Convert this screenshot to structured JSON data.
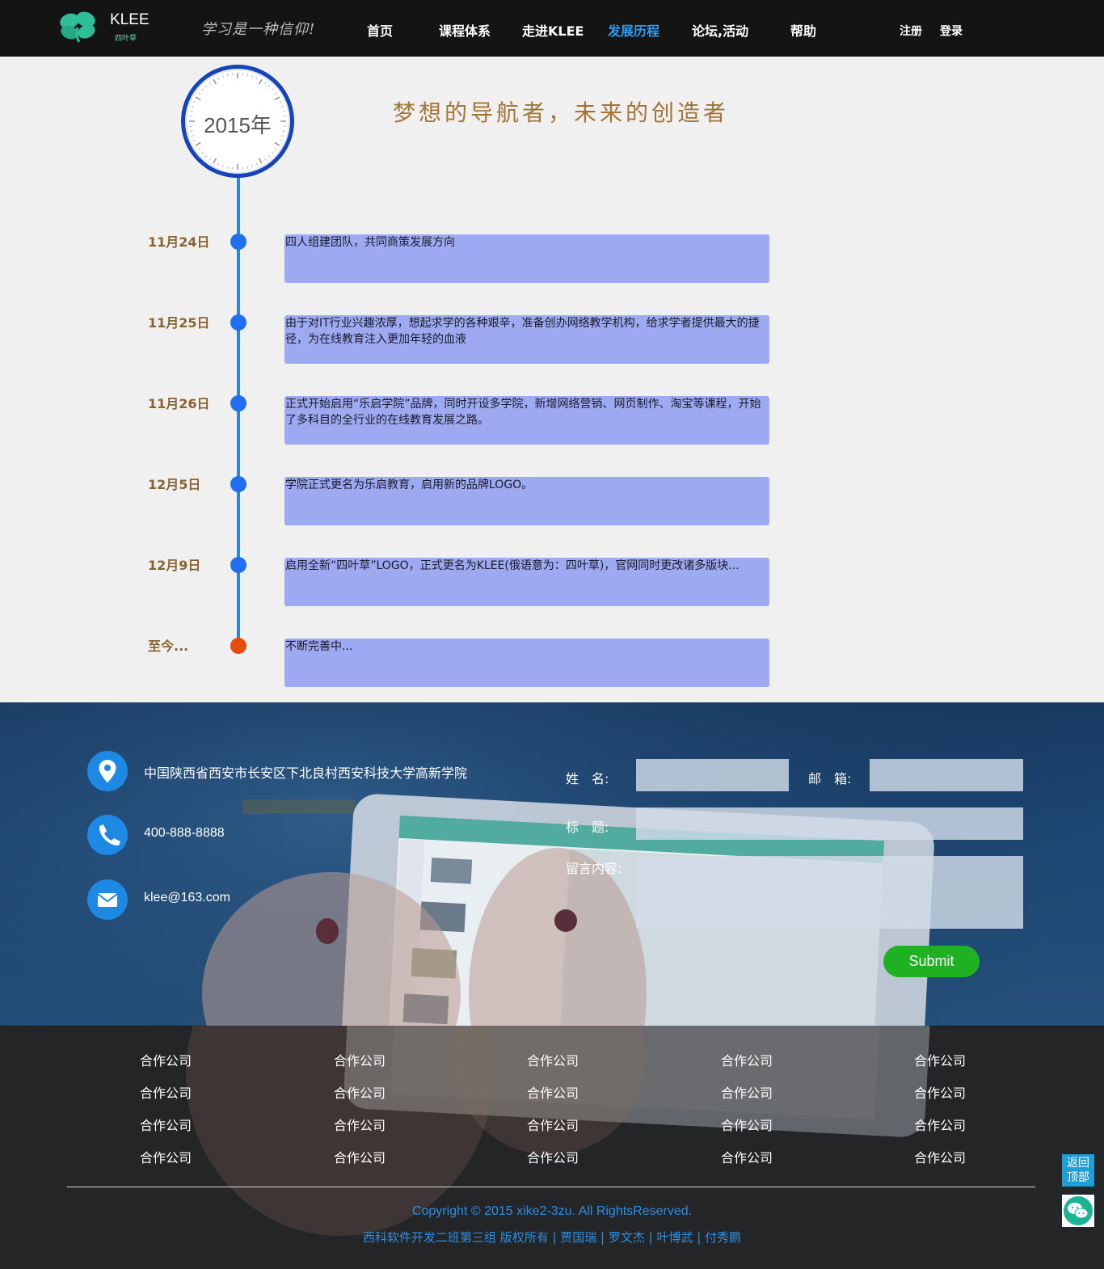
{
  "header": {
    "logo_text": "KLEE",
    "logo_sub": "四叶草",
    "slogan": "学习是一种信仰!",
    "nav": [
      {
        "label": "首页"
      },
      {
        "label": "课程体系"
      },
      {
        "label": "走进KLEE"
      },
      {
        "label": "发展历程",
        "active": true
      },
      {
        "label": "论坛,活动"
      },
      {
        "label": "帮助"
      }
    ],
    "register": "注册",
    "login": "登录"
  },
  "timeline": {
    "year": "2015年",
    "headline": "梦想的导航者，未来的创造者",
    "events": [
      {
        "date": "11月24日",
        "text": "四人组建团队，共同商策发展方向"
      },
      {
        "date": "11月25日",
        "text": "由于对IT行业兴趣浓厚，想起求学的各种艰辛，准备创办网络教学机构，给求学者提供最大的捷径，为在线教育注入更加年轻的血液"
      },
      {
        "date": "11月26日",
        "text": "正式开始启用“乐启学院”品牌，同时开设多学院，新增网络营销、网页制作、淘宝等课程，开始了多科目的全行业的在线教育发展之路。"
      },
      {
        "date": "12月5日",
        "text": "学院正式更名为乐启教育，启用新的品牌LOGO。"
      },
      {
        "date": "12月9日",
        "text": "启用全新“四叶草”LOGO，正式更名为KLEE(俄语意为：四叶草)，官网同时更改诸多版块..."
      },
      {
        "date": "至今...",
        "text": "不断完善中...",
        "current": true
      }
    ]
  },
  "contact": {
    "address": "中国陕西省西安市长安区下北良村西安科技大学高新学院",
    "phone": "400-888-8888",
    "email": "klee@163.com"
  },
  "form": {
    "name_label": "姓　名:",
    "email_label": "邮　箱:",
    "subject_label": "标　题:",
    "message_label": "留言内容:",
    "name_value": "",
    "email_value": "",
    "subject_value": "",
    "message_value": "",
    "submit_label": "Submit"
  },
  "footer": {
    "partners": [
      [
        "合作公司",
        "合作公司",
        "合作公司",
        "合作公司",
        "合作公司"
      ],
      [
        "合作公司",
        "合作公司",
        "合作公司",
        "合作公司",
        "合作公司"
      ],
      [
        "合作公司",
        "合作公司",
        "合作公司",
        "合作公司",
        "合作公司"
      ],
      [
        "合作公司",
        "合作公司",
        "合作公司",
        "合作公司",
        "合作公司"
      ]
    ],
    "copyright": "Copyright © 2015 xike2-3zu. All RightsReserved.",
    "credits": "西科软件开发二班第三组 版权所有 | 贾国瑞 | 罗文杰 | 叶博武 | 付秀鹏"
  },
  "floating": {
    "back_top_line1": "返回",
    "back_top_line2": "顶部"
  },
  "colors": {
    "header_bg": "#141414",
    "nav_active": "#2d9bef",
    "timeline_line": "#2f80e8",
    "timeline_dot": "#1f6ff0",
    "timeline_dot_current": "#e64a0c",
    "event_box": "#9da9f0",
    "date_text": "#8a6430",
    "headline_text": "#a37436",
    "submit_bg": "#1fb122",
    "link_blue": "#2c8fe6"
  },
  "icons": [
    "clover-logo-icon",
    "location-pin-icon",
    "phone-icon",
    "envelope-icon",
    "wechat-icon"
  ]
}
